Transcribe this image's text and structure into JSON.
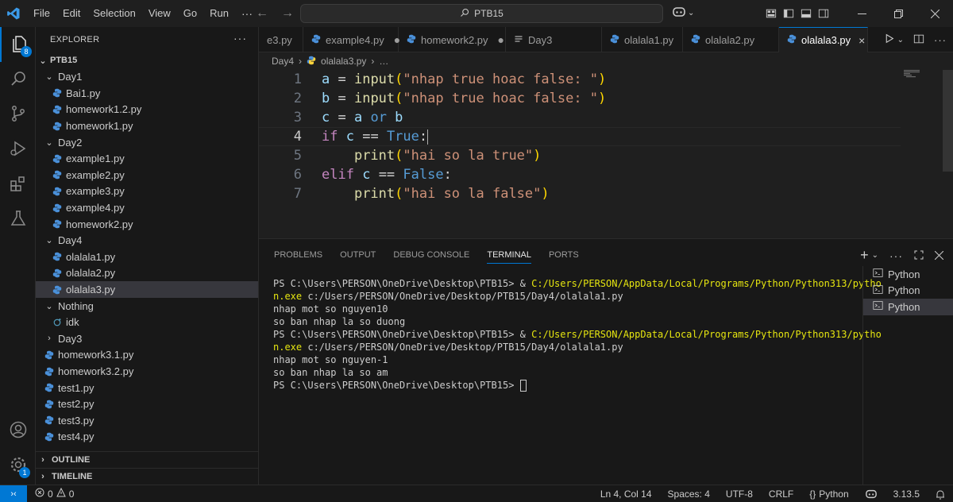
{
  "titlebar": {
    "menu": [
      "File",
      "Edit",
      "Selection",
      "View",
      "Go",
      "Run"
    ],
    "more": "···",
    "search_text": "PTB15"
  },
  "activity": {
    "explorer_badge": "8",
    "accounts_badge": "1"
  },
  "sidebar": {
    "title": "EXPLORER",
    "more": "···",
    "root": "PTB15",
    "tree": [
      {
        "label": "Day1",
        "type": "folder",
        "indent": 1,
        "open": true
      },
      {
        "label": "Bai1.py",
        "type": "py",
        "indent": 2
      },
      {
        "label": "homework1.2.py",
        "type": "py",
        "indent": 2
      },
      {
        "label": "homework1.py",
        "type": "py",
        "indent": 2
      },
      {
        "label": "Day2",
        "type": "folder",
        "indent": 1,
        "open": true
      },
      {
        "label": "example1.py",
        "type": "py",
        "indent": 2
      },
      {
        "label": "example2.py",
        "type": "py",
        "indent": 2
      },
      {
        "label": "example3.py",
        "type": "py",
        "indent": 2
      },
      {
        "label": "example4.py",
        "type": "py",
        "indent": 2
      },
      {
        "label": "homework2.py",
        "type": "py",
        "indent": 2
      },
      {
        "label": "Day4",
        "type": "folder",
        "indent": 1,
        "open": true
      },
      {
        "label": "olalala1.py",
        "type": "py",
        "indent": 2
      },
      {
        "label": "olalala2.py",
        "type": "py",
        "indent": 2
      },
      {
        "label": "olalala3.py",
        "type": "py",
        "indent": 2,
        "selected": true
      },
      {
        "label": "Nothing",
        "type": "folder",
        "indent": 1,
        "open": true
      },
      {
        "label": "idk",
        "type": "jupyter",
        "indent": 2
      },
      {
        "label": "Day3",
        "type": "folder",
        "indent": 1,
        "open": false
      },
      {
        "label": "homework3.1.py",
        "type": "py",
        "indent": 1
      },
      {
        "label": "homework3.2.py",
        "type": "py",
        "indent": 1
      },
      {
        "label": "test1.py",
        "type": "py",
        "indent": 1
      },
      {
        "label": "test2.py",
        "type": "py",
        "indent": 1
      },
      {
        "label": "test3.py",
        "type": "py",
        "indent": 1
      },
      {
        "label": "test4.py",
        "type": "py",
        "indent": 1
      }
    ],
    "outline": "OUTLINE",
    "timeline": "TIMELINE"
  },
  "tabs": [
    {
      "label": "e3.py",
      "icon": "none",
      "close": ""
    },
    {
      "label": "example4.py",
      "icon": "python",
      "close": "●"
    },
    {
      "label": "homework2.py",
      "icon": "python",
      "close": "●"
    },
    {
      "label": "Day3",
      "icon": "text",
      "close": ""
    },
    {
      "label": "olalala1.py",
      "icon": "python",
      "close": ""
    },
    {
      "label": "olalala2.py",
      "icon": "python",
      "close": ""
    },
    {
      "label": "olalala3.py",
      "icon": "python",
      "close": "×",
      "active": true
    }
  ],
  "breadcrumb": {
    "folder": "Day4",
    "file": "olalala3.py",
    "rest": "…"
  },
  "code": {
    "line_numbers": [
      "1",
      "2",
      "3",
      "4",
      "5",
      "6",
      "7"
    ],
    "line1": {
      "var": "a",
      "eq": " = ",
      "fn": "input",
      "open": "(",
      "str": "\"nhap true hoac false: \"",
      "close": ")"
    },
    "line2": {
      "var": "b",
      "eq": " = ",
      "fn": "input",
      "open": "(",
      "str": "\"nhap true hoac false: \"",
      "close": ")"
    },
    "line3": {
      "var": "c",
      "eq": " = ",
      "a": "a",
      "kw": " or ",
      "b": "b"
    },
    "line4": {
      "kw": "if",
      "sp": " ",
      "var": "c",
      "op": " == ",
      "val": "True",
      "colon": ":"
    },
    "line5": {
      "indent": "    ",
      "fn": "print",
      "open": "(",
      "str": "\"hai so la true\"",
      "close": ")"
    },
    "line6": {
      "kw": "elif",
      "sp": " ",
      "var": "c",
      "op": " == ",
      "val": "False",
      "colon": ":"
    },
    "line7": {
      "indent": "    ",
      "fn": "print",
      "open": "(",
      "str": "\"hai so la false\"",
      "close": ")"
    }
  },
  "panel": {
    "tabs": [
      "PROBLEMS",
      "OUTPUT",
      "DEBUG CONSOLE",
      "TERMINAL",
      "PORTS"
    ],
    "active_tab": "TERMINAL",
    "terminal_lines": [
      {
        "prompt": "PS C:\\Users\\PERSON\\OneDrive\\Desktop\\PTB15> & ",
        "cmd": "C:/Users/PERSON/AppData/Local/Programs/Python/Python313/pytho"
      },
      {
        "prompt": "",
        "cmd": "n.exe",
        "rest": " c:/Users/PERSON/OneDrive/Desktop/PTB15/Day4/olalala1.py"
      },
      {
        "prompt": "nhap mot so nguyen10"
      },
      {
        "prompt": "so ban nhap la so duong"
      },
      {
        "prompt": "PS C:\\Users\\PERSON\\OneDrive\\Desktop\\PTB15> & ",
        "cmd": "C:/Users/PERSON/AppData/Local/Programs/Python/Python313/pytho"
      },
      {
        "prompt": "",
        "cmd": "n.exe",
        "rest": " c:/Users/PERSON/OneDrive/Desktop/PTB15/Day4/olalala1.py"
      },
      {
        "prompt": "nhap mot so nguyen-1"
      },
      {
        "prompt": "so ban nhap la so am"
      },
      {
        "prompt": "PS C:\\Users\\PERSON\\OneDrive\\Desktop\\PTB15> "
      }
    ],
    "terminals": [
      "Python",
      "Python",
      "Python"
    ]
  },
  "statusbar": {
    "errors": "0",
    "warnings": "0",
    "position": "Ln 4, Col 14",
    "spaces": "Spaces: 4",
    "encoding": "UTF-8",
    "eol": "CRLF",
    "language_braces": "{}",
    "language": "Python",
    "version": "3.13.5"
  },
  "colors": {
    "accent": "#0078d4",
    "keyword": "#c586c0",
    "variable": "#9cdcfe",
    "function": "#dcdcaa",
    "string": "#ce9178",
    "constant": "#569cd6",
    "python_blue": "#3572a5",
    "python_yellow": "#ffd43b"
  }
}
